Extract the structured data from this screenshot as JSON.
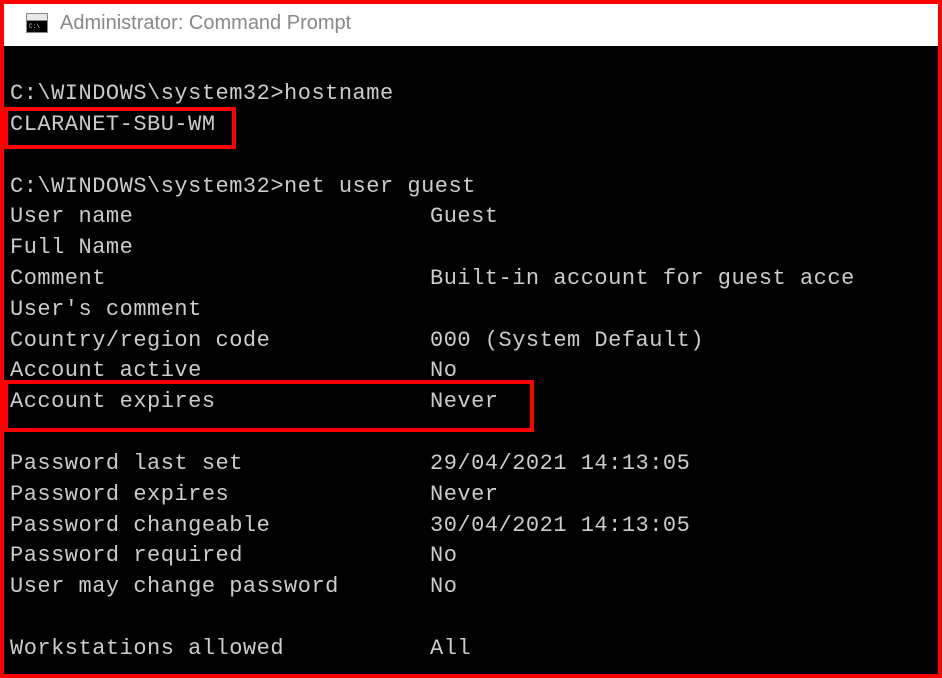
{
  "window": {
    "title": "Administrator: Command Prompt"
  },
  "terminal": {
    "prompt1": "C:\\WINDOWS\\system32>hostname",
    "hostname_output": "CLARANET-SBU-WM",
    "prompt2": "C:\\WINDOWS\\system32>net user guest",
    "rows": [
      {
        "label": "User name",
        "value": "Guest"
      },
      {
        "label": "Full Name",
        "value": ""
      },
      {
        "label": "Comment",
        "value": "Built-in account for guest acce"
      },
      {
        "label": "User's comment",
        "value": ""
      },
      {
        "label": "Country/region code",
        "value": "000 (System Default)"
      },
      {
        "label": "Account active",
        "value": "No"
      },
      {
        "label": "Account expires",
        "value": "Never"
      }
    ],
    "rows2": [
      {
        "label": "Password last set",
        "value": "29/04/2021 14:13:05"
      },
      {
        "label": "Password expires",
        "value": "Never"
      },
      {
        "label": "Password changeable",
        "value": "30/04/2021 14:13:05"
      },
      {
        "label": "Password required",
        "value": "No"
      },
      {
        "label": "User may change password",
        "value": "No"
      }
    ],
    "rows3": [
      {
        "label": "Workstations allowed",
        "value": "All"
      }
    ]
  }
}
